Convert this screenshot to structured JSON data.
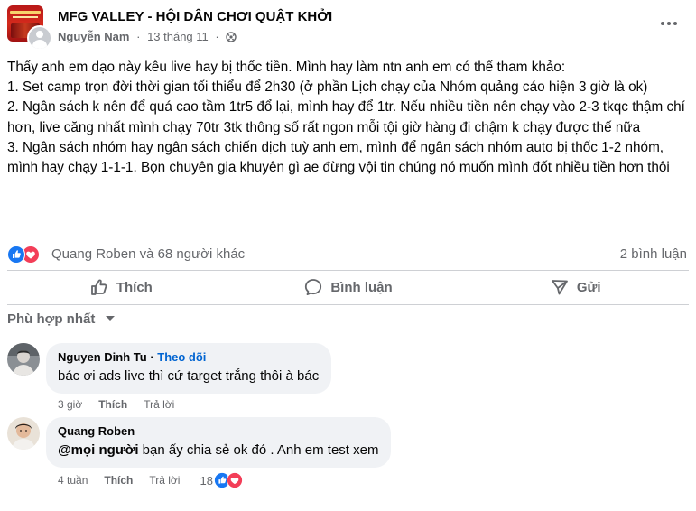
{
  "post": {
    "group_name": "MFG VALLEY - HỘI DÂN CHƠI QUẬT KHỞI",
    "author": "Nguyễn Nam",
    "separator": "·",
    "date": "13 tháng 11",
    "dot": "·",
    "body": [
      "Thấy anh em dạo này kêu live hay bị thốc tiền. Mình hay làm ntn anh em có thể tham khảo:",
      "1. Set camp trọn đời thời gian tối thiểu để 2h30 (ở phần Lịch chạy của Nhóm quảng cáo hiện 3 giờ là ok)",
      "2. Ngân sách k nên để quá cao tầm 1tr5 đổ lại, mình hay để 1tr. Nếu nhiều tiền nên chạy vào 2-3 tkqc thậm chí hơn, live căng nhất mình chạy 70tr 3tk thông số rất ngon mỗi tội giờ hàng đi chậm k chạy được thế nữa",
      "3. Ngân sách nhóm hay ngân sách chiến dịch tuỳ anh em, mình để ngân sách nhóm auto bị thốc 1-2 nhóm, mình hay chạy 1-1-1. Bọn chuyên gia khuyên gì ae đừng vội tin chúng nó muốn mình đốt nhiều tiền hơn thôi"
    ],
    "reactions": {
      "names": "Quang Roben và 68 người khác",
      "comments": "2 bình luận"
    },
    "actions": {
      "like": "Thích",
      "comment": "Bình luận",
      "share": "Gửi"
    },
    "sort_label": "Phù hợp nhất"
  },
  "comments": [
    {
      "name": "Nguyen Dinh Tu",
      "follow": "Theo dõi",
      "mention": "",
      "text": "bác ơi ads live thì cứ target trắng thôi à bác",
      "time": "3 giờ",
      "like": "Thích",
      "reply": "Trả lời",
      "reaction_count": ""
    },
    {
      "name": "Quang Roben",
      "follow": "",
      "mention": "@mọi người",
      "text": " bạn ấy chia sẻ ok đó . Anh em test xem",
      "time": "4 tuần",
      "like": "Thích",
      "reply": "Trả lời",
      "reaction_count": "18"
    }
  ],
  "colors": {
    "like_blue": "#1877f2",
    "love_red": "#f33e58",
    "muted_text": "#65676b",
    "bubble_bg": "#f0f2f5",
    "link_blue": "#0064d1"
  }
}
